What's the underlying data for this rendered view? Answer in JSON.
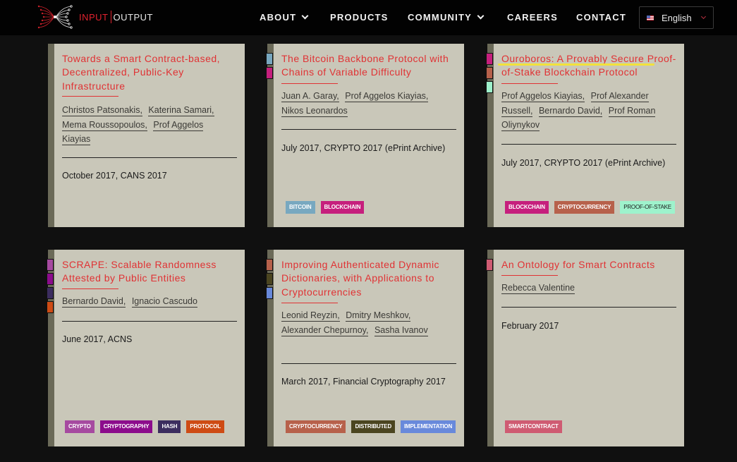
{
  "header": {
    "logo": {
      "input": "INPUT",
      "output": "OUTPUT"
    },
    "nav": [
      {
        "label": "ABOUT",
        "dropdown": true
      },
      {
        "label": "PRODUCTS",
        "dropdown": false
      },
      {
        "label": "COMMUNITY",
        "dropdown": true
      },
      {
        "label": "CAREERS",
        "dropdown": false
      },
      {
        "label": "CONTACT",
        "dropdown": false
      }
    ],
    "language": {
      "label": "English",
      "icon": "us-flag-icon"
    }
  },
  "tag_colors": {
    "BITCOIN": "#78a8c0",
    "BLOCKCHAIN": "#c61f7d",
    "CRYPTOCURRENCY": "#b7614b",
    "PROOF-OF-STAKE": "#9ef2cc",
    "CRYPTO": "#a64aa0",
    "CRYPTOGRAPHY": "#8c0c8c",
    "HASH": "#3c2d5f",
    "PROTOCOL": "#ce4b14",
    "DISTRIBUTED": "#4b4520",
    "IMPLEMENTATION": "#6889db",
    "SMARTCONTRACT": "#cf5b72"
  },
  "papers": [
    {
      "title": "Towards a Smart Contract-based, Decentralized, Public-Key Infrastructure",
      "authors": [
        "Christos Patsonakis,",
        "Katerina Samari,",
        "Mema Roussopoulos,",
        "Prof Aggelos Kiayias"
      ],
      "publication": "October 2017, CANS 2017",
      "tags": []
    },
    {
      "title": "The Bitcoin Backbone Protocol with Chains of Variable Difficulty",
      "authors": [
        "Juan A. Garay,",
        "Prof Aggelos Kiayias,",
        "Nikos Leonardos"
      ],
      "publication": "July 2017, CRYPTO 2017 (ePrint Archive)",
      "tags": [
        "BITCOIN",
        "BLOCKCHAIN"
      ]
    },
    {
      "title": "Ouroboros: A Provably Secure Proof-of-Stake Blockchain Protocol",
      "authors": [
        "Prof Aggelos Kiayias,",
        "Prof Alexander Russell,",
        "Bernardo David,",
        "Prof Roman Oliynykov"
      ],
      "publication": "July 2017, CRYPTO 2017 (ePrint Archive)",
      "tags": [
        "BLOCKCHAIN",
        "CRYPTOCURRENCY",
        "PROOF-OF-STAKE"
      ],
      "highlighted": true
    },
    {
      "title": "SCRAPE: Scalable Randomness Attested by Public Entities",
      "authors": [
        "Bernardo David,",
        "Ignacio Cascudo"
      ],
      "publication": "June 2017, ACNS",
      "tags": [
        "CRYPTO",
        "CRYPTOGRAPHY",
        "HASH",
        "PROTOCOL"
      ]
    },
    {
      "title": "Improving Authenticated Dynamic Dictionaries, with Applications to Cryptocurrencies",
      "authors": [
        "Leonid Reyzin,",
        "Dmitry Meshkov,",
        "Alexander Chepurnoy,",
        "Sasha Ivanov"
      ],
      "publication": "March 2017, Financial Cryptography 2017",
      "tags": [
        "CRYPTOCURRENCY",
        "DISTRIBUTED",
        "IMPLEMENTATION"
      ]
    },
    {
      "title": "An Ontology for Smart Contracts",
      "authors": [
        "Rebecca Valentine"
      ],
      "publication": "February 2017",
      "tags": [
        "SMARTCONTRACT"
      ]
    }
  ]
}
